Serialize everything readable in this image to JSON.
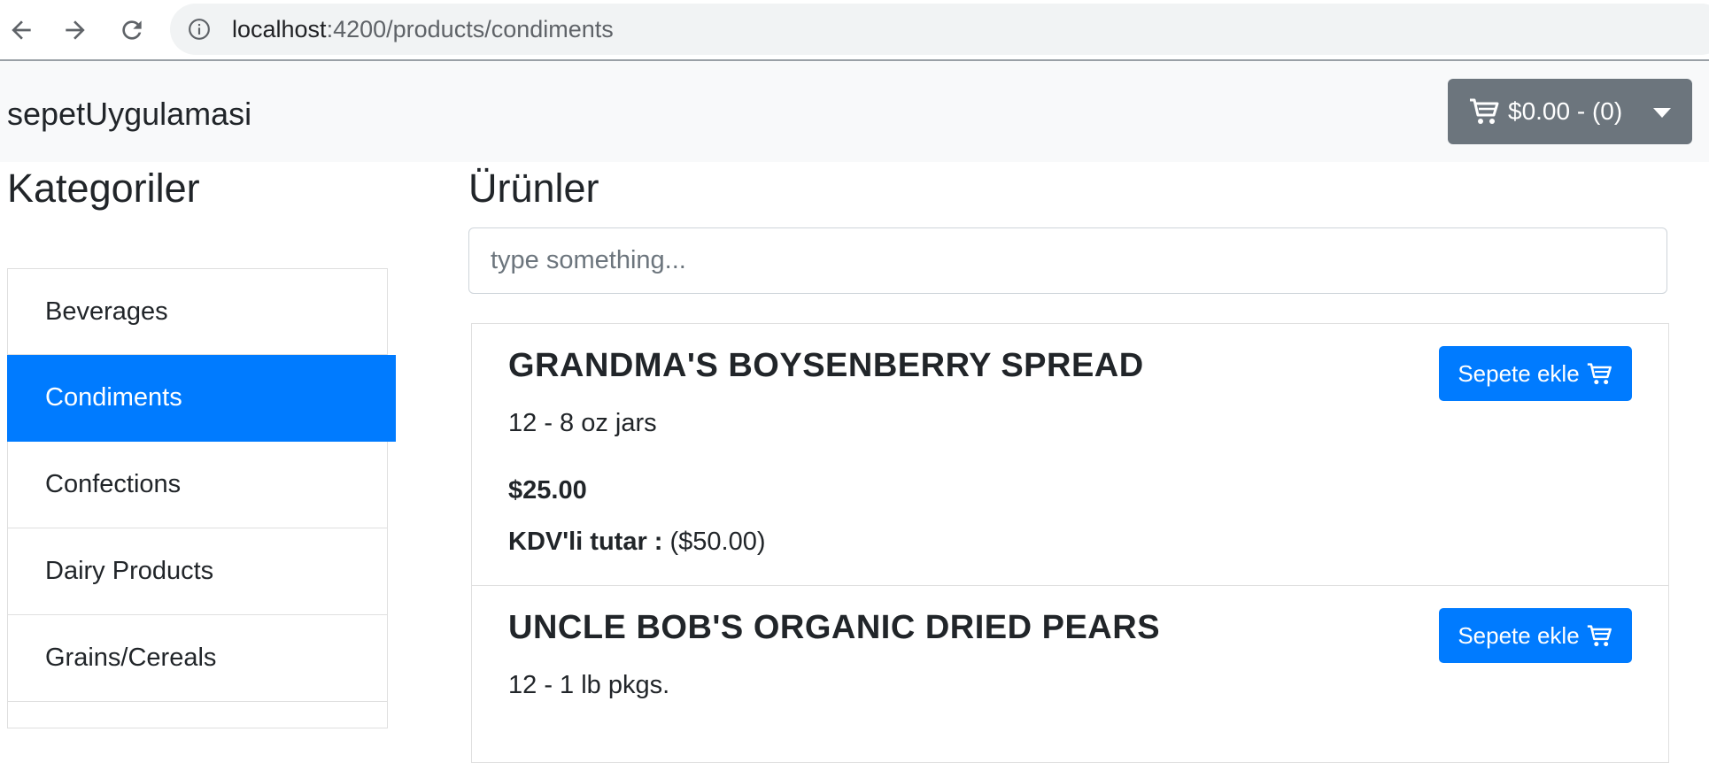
{
  "browser": {
    "url_host": "localhost",
    "url_path": ":4200/products/condiments",
    "icons": [
      "back-arrow-icon",
      "forward-arrow-icon",
      "reload-icon",
      "info-icon"
    ]
  },
  "navbar": {
    "brand": "sepetUygulamasi",
    "cart_label": "$0.00 - (0)"
  },
  "categories": {
    "title": "Kategoriler",
    "items": [
      {
        "label": "Beverages",
        "active": false
      },
      {
        "label": "Condiments",
        "active": true
      },
      {
        "label": "Confections",
        "active": false
      },
      {
        "label": "Dairy Products",
        "active": false
      },
      {
        "label": "Grains/Cereals",
        "active": false
      }
    ]
  },
  "products": {
    "title": "Ürünler",
    "search_placeholder": "type something...",
    "add_label": "Sepete ekle",
    "kdv_label": "KDV'li tutar :",
    "items": [
      {
        "name": "GRANDMA'S BOYSENBERRY SPREAD",
        "quantity": "12 - 8 oz jars",
        "price": "$25.00",
        "kdv_price": "($50.00)"
      },
      {
        "name": "UNCLE BOB'S ORGANIC DRIED PEARS",
        "quantity": "12 - 1 lb pkgs."
      }
    ]
  },
  "colors": {
    "primary": "#007bff",
    "secondary": "#6c757d",
    "navbar_bg": "#f8f9fa"
  }
}
